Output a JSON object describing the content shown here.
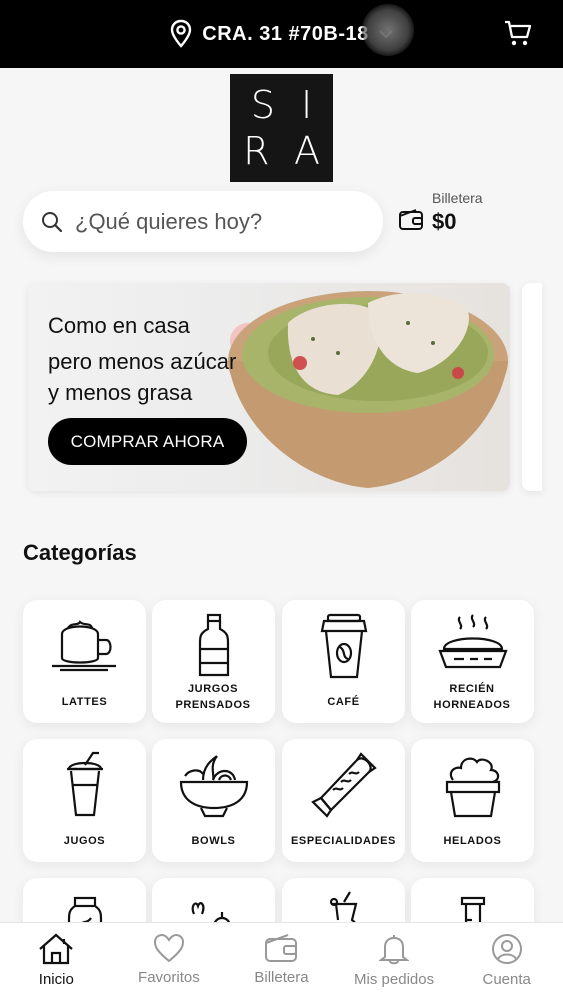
{
  "header": {
    "address": "CRA. 31 #70B-18",
    "location_icon": "location-pin-icon",
    "dropdown_icon": "chevron-down-icon",
    "cart_icon": "cart-icon"
  },
  "logo": {
    "line1": "SI",
    "line2": "RA"
  },
  "search": {
    "placeholder": "¿Qué quieres hoy?"
  },
  "wallet": {
    "label": "Billetera",
    "value": "$0"
  },
  "banner": {
    "line1": "Como en casa",
    "line2": "pero menos azúcar",
    "line3": "y menos grasa",
    "cta": "COMPRAR AHORA"
  },
  "categories": {
    "title": "Categorías",
    "items": [
      {
        "label": "LATTES",
        "icon": "latte-cup-icon"
      },
      {
        "label": "JURGOS PRENSADOS",
        "icon": "juice-bottle-icon"
      },
      {
        "label": "CAFÉ",
        "icon": "coffee-cup-icon"
      },
      {
        "label": "RECIÉN HORNEADOS",
        "icon": "pie-icon"
      },
      {
        "label": "JUGOS",
        "icon": "smoothie-cup-icon"
      },
      {
        "label": "BOWLS",
        "icon": "bowl-icon"
      },
      {
        "label": "ESPECIALIDADES",
        "icon": "wrap-icon"
      },
      {
        "label": "HELADOS",
        "icon": "ice-cream-icon"
      }
    ]
  },
  "nav": {
    "items": [
      {
        "label": "Inicio",
        "icon": "home-icon",
        "active": true
      },
      {
        "label": "Favoritos",
        "icon": "heart-icon"
      },
      {
        "label": "Billetera",
        "icon": "wallet-icon"
      },
      {
        "label": "Mis pedidos",
        "icon": "bell-icon"
      },
      {
        "label": "Cuenta",
        "icon": "user-icon"
      }
    ]
  },
  "colors": {
    "topbar": "#000000",
    "background": "#f6f6f7",
    "cta": "#000000",
    "active_nav": "#111111",
    "inactive_nav": "#888888"
  }
}
